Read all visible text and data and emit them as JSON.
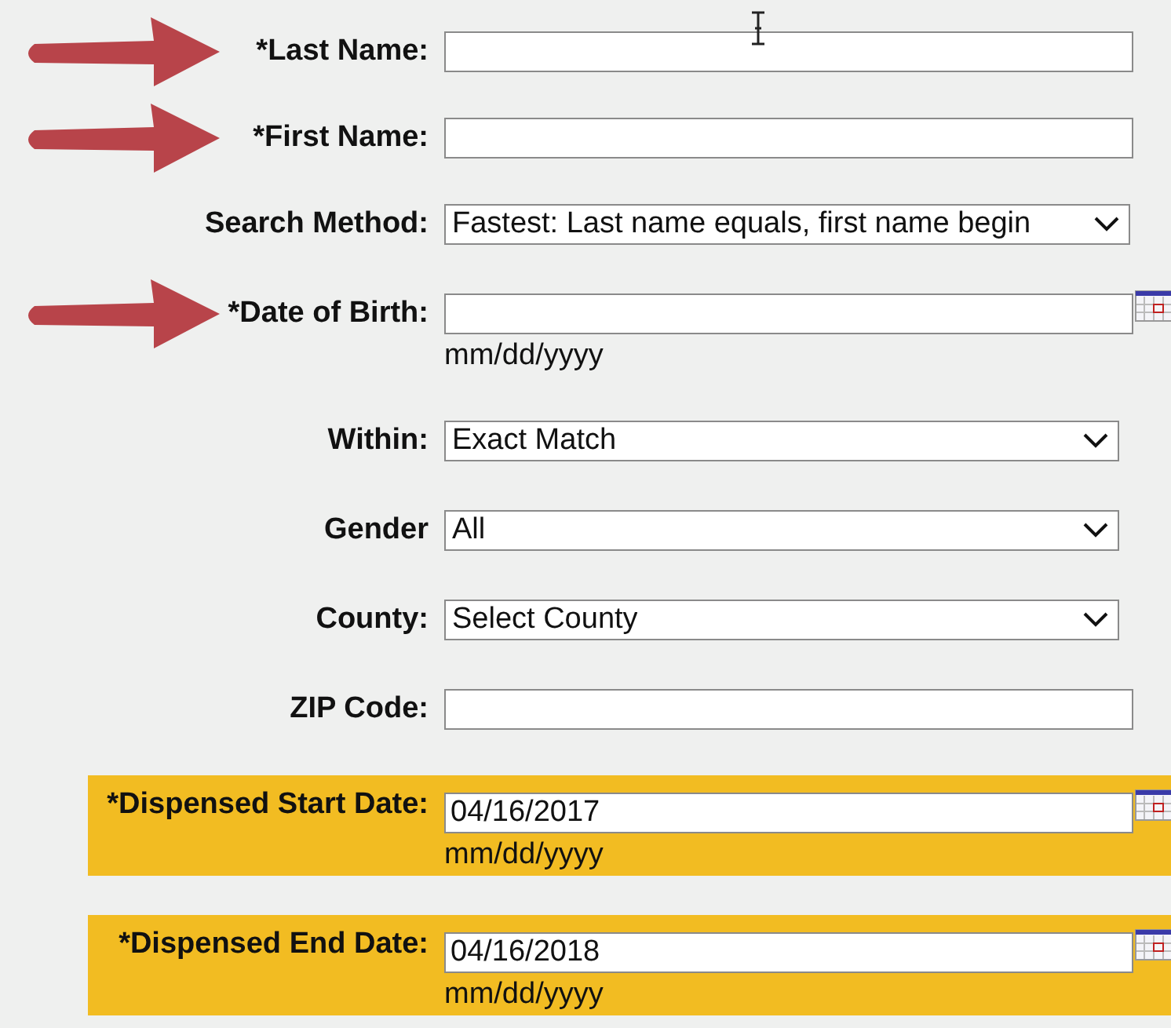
{
  "fields": [
    {
      "label": "*Last Name:",
      "kind": "text",
      "arrow": true,
      "highlighted": false
    },
    {
      "label": "*First Name:",
      "kind": "text",
      "arrow": true,
      "highlighted": false
    },
    {
      "label": "Search Method:",
      "kind": "select",
      "arrow": false,
      "highlighted": false,
      "value": "Fastest: Last name equals, first name begin"
    },
    {
      "label": "*Date of Birth:",
      "kind": "date",
      "arrow": true,
      "highlighted": false,
      "hint": "mm/dd/yyyy"
    },
    {
      "label": "Within:",
      "kind": "select",
      "arrow": false,
      "highlighted": false,
      "value": "Exact Match"
    },
    {
      "label": "Gender",
      "kind": "select",
      "arrow": false,
      "highlighted": false,
      "value": "All"
    },
    {
      "label": "County:",
      "kind": "select",
      "arrow": false,
      "highlighted": false,
      "value": "Select County"
    },
    {
      "label": "ZIP Code:",
      "kind": "text",
      "arrow": false,
      "highlighted": false
    },
    {
      "label": "*Dispensed Start Date:",
      "kind": "date",
      "arrow": false,
      "highlighted": true,
      "value": "04/16/2017",
      "hint": "mm/dd/yyyy"
    },
    {
      "label": "*Dispensed End Date:",
      "kind": "date",
      "arrow": false,
      "highlighted": true,
      "value": "04/16/2018",
      "hint": "mm/dd/yyyy"
    }
  ]
}
